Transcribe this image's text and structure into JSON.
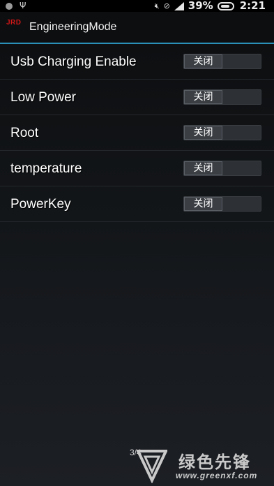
{
  "status_bar": {
    "battery_percent": "39%",
    "time": "2:21",
    "icons": [
      "notification-dot-icon",
      "usb-icon",
      "mute-icon",
      "no-signal-icon",
      "signal-icon",
      "battery-icon"
    ]
  },
  "action_bar": {
    "logo_text": "JRD",
    "title": "EngineeringMode"
  },
  "settings": {
    "items": [
      {
        "label": "Usb Charging Enable",
        "toggle_text": "关闭"
      },
      {
        "label": "Low Power",
        "toggle_text": "关闭"
      },
      {
        "label": "Root",
        "toggle_text": "关闭"
      },
      {
        "label": "temperature",
        "toggle_text": "关闭"
      },
      {
        "label": "PowerKey",
        "toggle_text": "关闭"
      }
    ]
  },
  "page_indicator": "3/4",
  "watermark": {
    "chinese_text": "绿色先锋",
    "url": "www.greenxf.com"
  },
  "colors": {
    "accent_line": "#2a90b8",
    "logo_red": "#d01818",
    "background": "#131619"
  }
}
